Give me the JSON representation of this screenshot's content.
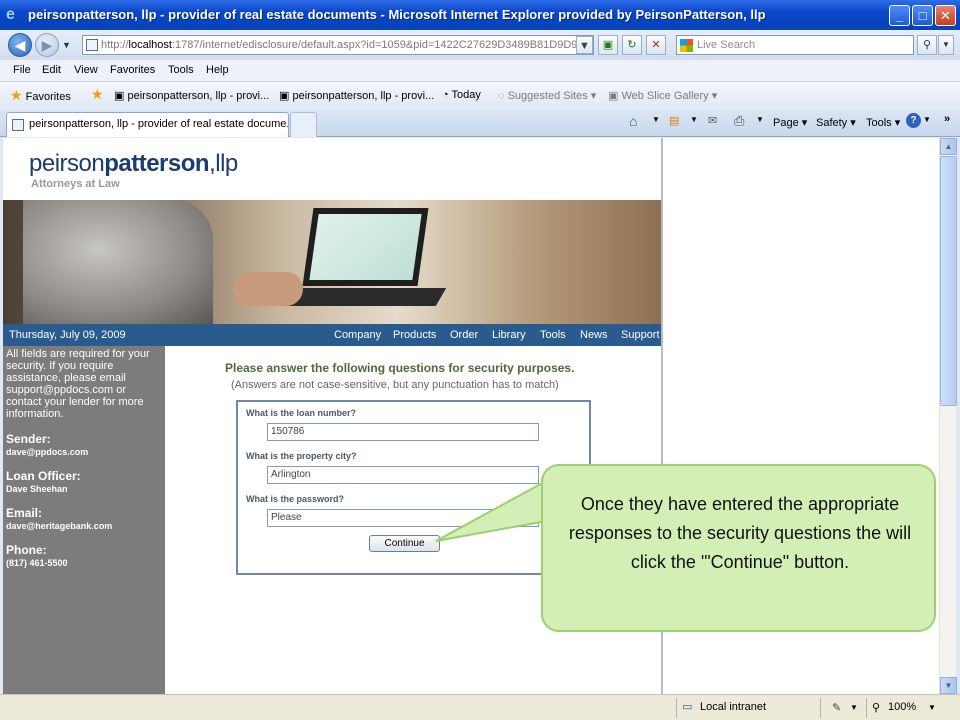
{
  "window": {
    "title": "peirsonpatterson, llp - provider of real estate documents - Microsoft Internet Explorer provided by PeirsonPatterson, llp",
    "min": "_",
    "max": "□",
    "close": "✕"
  },
  "address": {
    "url_prefix": "http://",
    "url_host": "localhost",
    "url_rest": ":1787/internet/edisclosure/default.aspx?id=1059&pid=1422C27629D3489B81D9D9307C",
    "search_placeholder": "Live Search"
  },
  "menu": [
    "File",
    "Edit",
    "View",
    "Favorites",
    "Tools",
    "Help"
  ],
  "favorites_bar": {
    "favorites_label": "Favorites",
    "links": [
      "peirsonpatterson, llp - provi...",
      "peirsonpatterson, llp - provi...",
      "Today"
    ],
    "suggested_sites": "Suggested Sites",
    "web_slice_gallery": "Web Slice Gallery"
  },
  "tabs": {
    "active_label": "peirsonpatterson, llp - provider of real estate docume..."
  },
  "command_bar": {
    "page": "Page",
    "safety": "Safety",
    "tools": "Tools"
  },
  "site": {
    "logo_light": "peirson",
    "logo_bold": "patterson",
    "logo_tail": ",llp",
    "logo_sub": "Attorneys at Law",
    "date": "Thursday, July 09, 2009",
    "nav": [
      "Company",
      "Products",
      "Order",
      "Library",
      "Tools",
      "News",
      "Support"
    ]
  },
  "sidebar": {
    "intro": "All fields are required for your security. If you require assistance, please email support@ppdocs.com or contact your lender for more information.",
    "sender_label": "Sender:",
    "sender_value": "dave@ppdocs.com",
    "loan_officer_label": "Loan Officer:",
    "loan_officer_value": "Dave Sheehan",
    "email_label": "Email:",
    "email_value": "dave@heritagebank.com",
    "phone_label": "Phone:",
    "phone_value": "(817) 461-5500"
  },
  "form": {
    "title": "Please answer the following questions for security purposes.",
    "note": "(Answers are not case-sensitive, but any punctuation has to match)",
    "q1_label": "What is the loan number?",
    "q1_value": "150786",
    "q2_label": "What is the property city?",
    "q2_value": "Arlington",
    "q3_label": "What is the password?",
    "q3_value": "Please",
    "continue_label": "Continue"
  },
  "callout": {
    "text": "Once they have entered the appropriate responses to the security questions the will click the '\"Continue\" button."
  },
  "status": {
    "zone": "Local intranet",
    "zoom": "100%"
  }
}
